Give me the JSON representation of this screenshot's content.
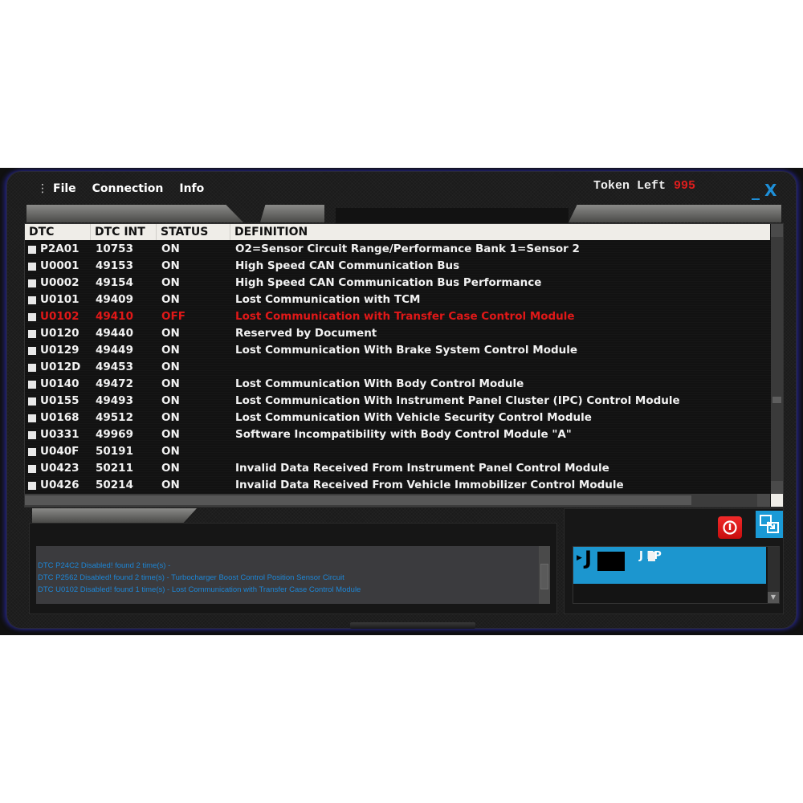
{
  "menu": {
    "items": [
      "File",
      "Connection",
      "Info"
    ]
  },
  "token": {
    "label": "Token Left",
    "value": "995"
  },
  "window_controls": {
    "minimize": "_",
    "close": "X"
  },
  "colors": {
    "accent_blue": "#1c96cf",
    "error_red": "#e01818",
    "log_text": "#1d86d6"
  },
  "table": {
    "headers": [
      "DTC",
      "DTC INT",
      "STATUS",
      "DEFINITION"
    ],
    "rows": [
      {
        "dtc": "P2A01",
        "dtc_int": "10753",
        "status": "ON",
        "definition": "O2=Sensor Circuit Range/Performance Bank 1=Sensor 2"
      },
      {
        "dtc": "U0001",
        "dtc_int": "49153",
        "status": "ON",
        "definition": "High Speed CAN Communication Bus"
      },
      {
        "dtc": "U0002",
        "dtc_int": "49154",
        "status": "ON",
        "definition": "High Speed CAN Communication Bus Performance"
      },
      {
        "dtc": "U0101",
        "dtc_int": "49409",
        "status": "ON",
        "definition": "Lost Communication with TCM"
      },
      {
        "dtc": "U0102",
        "dtc_int": "49410",
        "status": "OFF",
        "definition": "Lost Communication with Transfer Case Control Module"
      },
      {
        "dtc": "U0120",
        "dtc_int": "49440",
        "status": "ON",
        "definition": "Reserved by Document"
      },
      {
        "dtc": "U0129",
        "dtc_int": "49449",
        "status": "ON",
        "definition": "Lost Communication With Brake System Control Module"
      },
      {
        "dtc": "U012D",
        "dtc_int": "49453",
        "status": "ON",
        "definition": ""
      },
      {
        "dtc": "U0140",
        "dtc_int": "49472",
        "status": "ON",
        "definition": "Lost Communication With Body Control Module"
      },
      {
        "dtc": "U0155",
        "dtc_int": "49493",
        "status": "ON",
        "definition": "Lost Communication With Instrument Panel Cluster (IPC) Control Module"
      },
      {
        "dtc": "U0168",
        "dtc_int": "49512",
        "status": "ON",
        "definition": "Lost Communication With Vehicle Security Control Module"
      },
      {
        "dtc": "U0331",
        "dtc_int": "49969",
        "status": "ON",
        "definition": "Software Incompatibility with Body Control Module \"A\""
      },
      {
        "dtc": "U040F",
        "dtc_int": "50191",
        "status": "ON",
        "definition": ""
      },
      {
        "dtc": "U0423",
        "dtc_int": "50211",
        "status": "ON",
        "definition": "Invalid Data Received From Instrument Panel Control Module"
      },
      {
        "dtc": "U0426",
        "dtc_int": "50214",
        "status": "ON",
        "definition": "Invalid Data Received From Vehicle Immobilizer Control Module"
      }
    ]
  },
  "log": {
    "lines": [
      "DTC P24C2 Disabled! found 2 time(s) -",
      "DTC P2562 Disabled! found 2 time(s) - Turbocharger Boost Control Position Sensor Circuit",
      "DTC U0102 Disabled! found 1 time(s) - Lost Communication with Transfer Case Control Module"
    ]
  },
  "vehicle": {
    "brand": "J  p",
    "name": "J  EP"
  }
}
